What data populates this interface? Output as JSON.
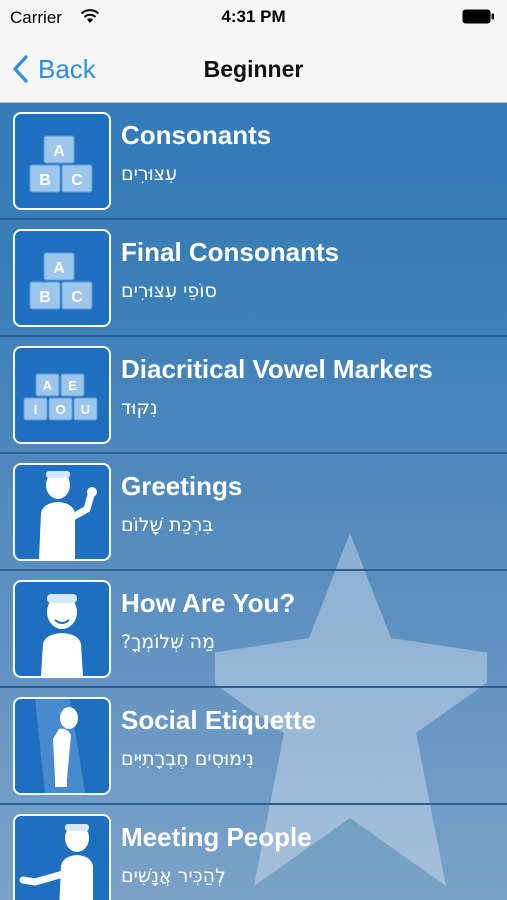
{
  "status": {
    "carrier": "Carrier",
    "time": "4:31 PM"
  },
  "nav": {
    "back_label": "Back",
    "title": "Beginner"
  },
  "items": [
    {
      "title": "Consonants",
      "subtitle": "עִצּוּרִים",
      "icon": "abc-blocks-icon"
    },
    {
      "title": "Final Consonants",
      "subtitle": "סוֹפֵי עִצּוּרִים",
      "icon": "abc-blocks-icon"
    },
    {
      "title": "Diacritical Vowel Markers",
      "subtitle": "נִקּוּד",
      "icon": "vowel-blocks-icon"
    },
    {
      "title": "Greetings",
      "subtitle": "בִּרְכַּת שָׁלוֹם",
      "icon": "waving-person-icon"
    },
    {
      "title": "How Are You?",
      "subtitle": "?מַה שְּׁלוֹמְךָ",
      "icon": "smiling-person-icon"
    },
    {
      "title": "Social Etiquette",
      "subtitle": "נִימוּסִים חֶבְרָתִיִּים",
      "icon": "bowing-person-icon"
    },
    {
      "title": "Meeting People",
      "subtitle": "לְהַכִּיר אֲנָשִׁים",
      "icon": "handshake-person-icon"
    }
  ],
  "blocks": {
    "abc": [
      "A",
      "B",
      "C"
    ],
    "vowels": [
      "A",
      "E",
      "I",
      "O",
      "U"
    ]
  },
  "colors": {
    "accent": "#2e8de0",
    "list_bg": "#3d80b8",
    "thumb_bg": "#1f6fc0"
  }
}
